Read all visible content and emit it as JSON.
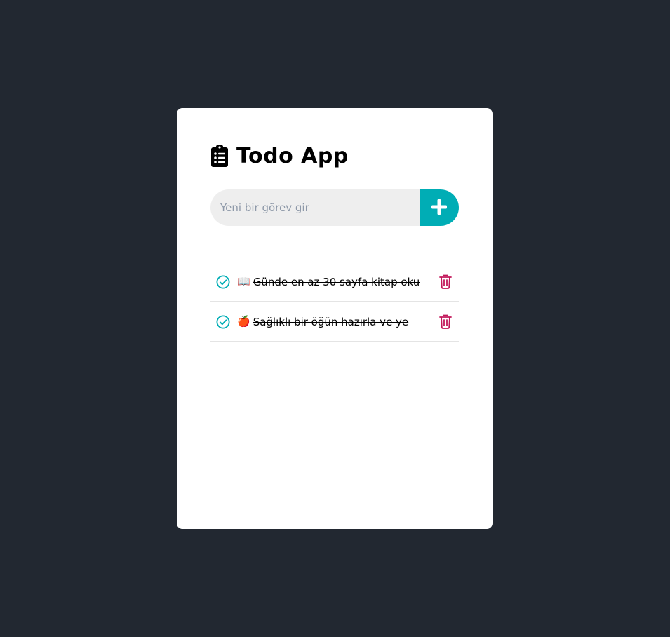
{
  "app": {
    "title": "Todo App"
  },
  "input": {
    "placeholder": "Yeni bir görev gir",
    "value": ""
  },
  "add_button": {
    "icon": "plus-icon"
  },
  "colors": {
    "background": "#222831",
    "accent": "#00adb5",
    "delete": "#c2185b",
    "input_bg": "#eeeeee"
  },
  "todos": [
    {
      "emoji": "📖",
      "text": "Günde en az 30 sayfa kitap oku",
      "completed": true
    },
    {
      "emoji": "🍎",
      "text": "Sağlıklı bir öğün hazırla ve ye",
      "completed": true
    }
  ]
}
